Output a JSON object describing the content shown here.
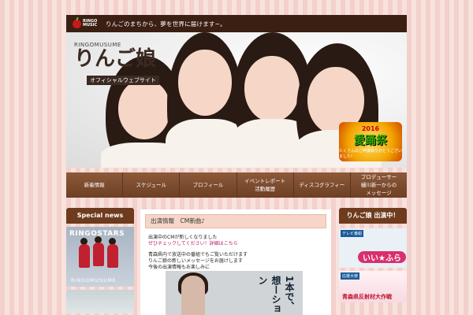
{
  "header": {
    "logo_text_1": "RINGO",
    "logo_text_2": "MUSIC",
    "tagline": "りんごのまちから、夢を世界に届けます~。"
  },
  "hero": {
    "brand_en": "RINGOMUSUME",
    "brand_jp": "りんご娘",
    "brand_sub": "オフィシャルウェブサイト",
    "event_year": "2016",
    "event_title": "愛踊祭",
    "event_note": "たくさんのご声援ありがとうございました!"
  },
  "nav": {
    "items": [
      {
        "label": "新着情報"
      },
      {
        "label": "スケジュール"
      },
      {
        "label": "プロフィール"
      },
      {
        "label": "イベントレポート\n活動履歴"
      },
      {
        "label": "ディスコグラフィー"
      },
      {
        "label": "プロデューサー\n樋川新一からの\nメッセージ"
      }
    ]
  },
  "left": {
    "title": "Special news",
    "img_title": "RINGOSTARS",
    "img_sub": "RINGOMUSUME"
  },
  "center": {
    "post_title": "出演情報　CM新曲♪",
    "line1": "出演中のCMが新しくなりました",
    "link": "ぜひチェックしてください！詳細はこちら",
    "line2": "青森県内で放送中の番組でもご覧いただけます",
    "line3": "りんご娘の新しいメッセージをお届けします",
    "line4": "今後の出演情報もお楽しみに",
    "ad_text": "1本で、想ーション"
  },
  "right": {
    "title": "りんご娘 出演中！",
    "badge1_label": "テレビ番組",
    "badge1_logo": "いい★ふら",
    "badge2_label": "応援大使",
    "badge2_title": "青森県反射材大作戦"
  }
}
